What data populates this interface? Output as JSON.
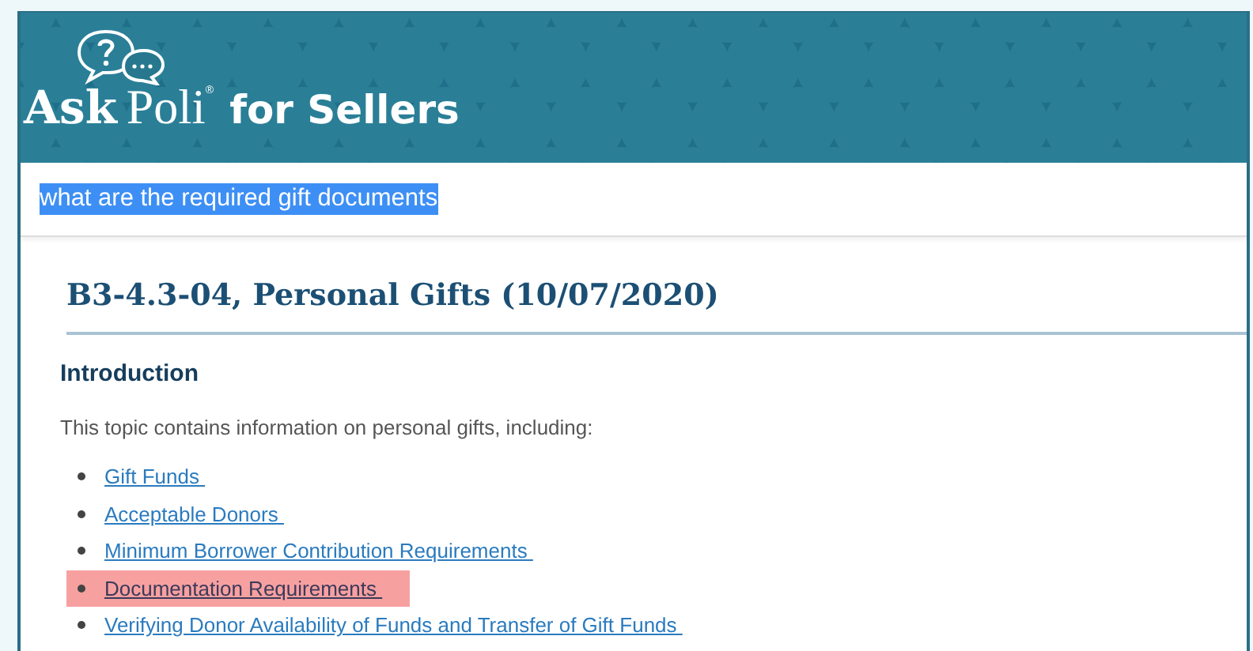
{
  "header": {
    "logo": {
      "ask": "Ask",
      "poli": "Poli",
      "mark": "®"
    },
    "subtitle": "for Sellers"
  },
  "search": {
    "value": "what are the required gift documents",
    "selected": true
  },
  "article": {
    "title": "B3-4.3-04, Personal Gifts (10/07/2020)",
    "section": "Introduction",
    "intro": "This topic contains information on personal gifts, including:",
    "links": [
      {
        "label": "Gift Funds ",
        "highlighted": false
      },
      {
        "label": "Acceptable Donors ",
        "highlighted": false
      },
      {
        "label": "Minimum Borrower Contribution Requirements ",
        "highlighted": false
      },
      {
        "label": "Documentation Requirements ",
        "highlighted": true
      },
      {
        "label": "Verifying Donor Availability of Funds and Transfer of Gift Funds ",
        "highlighted": false
      }
    ]
  }
}
